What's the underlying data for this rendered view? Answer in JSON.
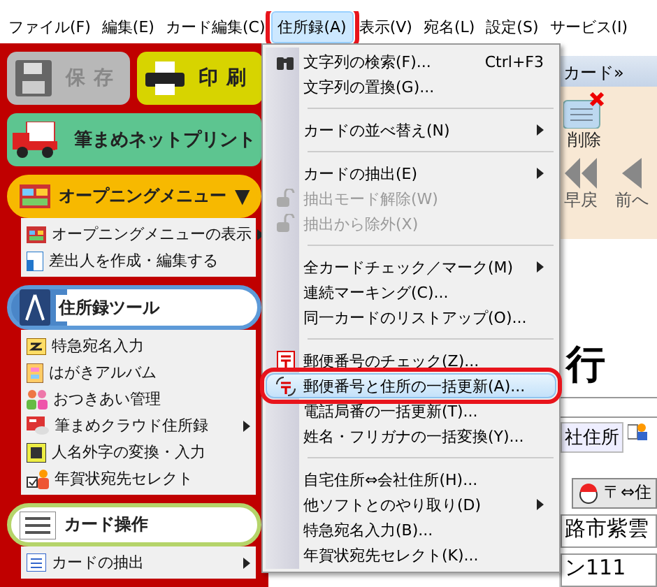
{
  "menu_bar": [
    {
      "label": "ファイル(F)",
      "selected": false,
      "callout": false
    },
    {
      "label": "編集(E)",
      "selected": false,
      "callout": false
    },
    {
      "label": "カード編集(C)",
      "selected": false,
      "callout": false
    },
    {
      "label": "住所録(A)",
      "selected": true,
      "callout": true
    },
    {
      "label": "表示(V)",
      "selected": false,
      "callout": false
    },
    {
      "label": "宛名(L)",
      "selected": false,
      "callout": false
    },
    {
      "label": "設定(S)",
      "selected": false,
      "callout": false
    },
    {
      "label": "サービス(I)",
      "selected": false,
      "callout": false
    }
  ],
  "left_panel": {
    "save_button": {
      "label": "保存",
      "disabled": true
    },
    "print_button": {
      "label": "印刷",
      "disabled": false
    },
    "net_print_button": {
      "label": "筆まめネットプリント"
    },
    "sections": [
      {
        "kind": "orange",
        "title": "オープニングメニュー",
        "toggle": "▼",
        "items": [
          {
            "label": "オープニングメニューの表示",
            "submenu": true
          },
          {
            "label": "差出人を作成・編集する",
            "submenu": false
          }
        ]
      },
      {
        "kind": "blue",
        "title": "住所録ツール",
        "items": [
          {
            "label": "特急宛名入力",
            "submenu": false
          },
          {
            "label": "はがきアルバム",
            "submenu": false
          },
          {
            "label": "おつきあい管理",
            "submenu": false
          },
          {
            "label": "筆まめクラウド住所録",
            "submenu": true
          },
          {
            "label": "人名外字の変換・入力",
            "submenu": false
          },
          {
            "label": "年賀状宛先セレクト",
            "submenu": false
          }
        ]
      },
      {
        "kind": "green",
        "title": "カード操作",
        "items": [
          {
            "label": "カードの抽出",
            "submenu": true
          }
        ]
      }
    ]
  },
  "dropdown": [
    {
      "kind": "item",
      "label": "文字列の検索(F)...",
      "shortcut": "Ctrl+F3",
      "submenu": false,
      "disabled": false,
      "selected": false,
      "callout": false
    },
    {
      "kind": "item",
      "label": "文字列の置換(G)...",
      "submenu": false,
      "disabled": false,
      "selected": false,
      "callout": false
    },
    {
      "kind": "separator"
    },
    {
      "kind": "item",
      "label": "カードの並べ替え(N)",
      "submenu": true,
      "disabled": false,
      "selected": false,
      "callout": false
    },
    {
      "kind": "separator"
    },
    {
      "kind": "item",
      "label": "カードの抽出(E)",
      "submenu": true,
      "disabled": false,
      "selected": false,
      "callout": false
    },
    {
      "kind": "item",
      "label": "抽出モード解除(W)",
      "submenu": false,
      "disabled": true,
      "selected": false,
      "callout": false
    },
    {
      "kind": "item",
      "label": "抽出から除外(X)",
      "submenu": false,
      "disabled": true,
      "selected": false,
      "callout": false
    },
    {
      "kind": "separator"
    },
    {
      "kind": "item",
      "label": "全カードチェック／マーク(M)",
      "submenu": true,
      "disabled": false,
      "selected": false,
      "callout": false
    },
    {
      "kind": "item",
      "label": "連続マーキング(C)...",
      "submenu": false,
      "disabled": false,
      "selected": false,
      "callout": false
    },
    {
      "kind": "item",
      "label": "同一カードのリストアップ(O)...",
      "submenu": false,
      "disabled": false,
      "selected": false,
      "callout": false
    },
    {
      "kind": "separator"
    },
    {
      "kind": "item",
      "label": "郵便番号のチェック(Z)...",
      "submenu": false,
      "disabled": false,
      "selected": false,
      "callout": false
    },
    {
      "kind": "item",
      "label": "郵便番号と住所の一括更新(A)...",
      "submenu": false,
      "disabled": false,
      "selected": true,
      "callout": true
    },
    {
      "kind": "item",
      "label": "電話局番の一括更新(T)...",
      "submenu": false,
      "disabled": false,
      "selected": false,
      "callout": false
    },
    {
      "kind": "item",
      "label": "姓名・フリガナの一括変換(Y)...",
      "submenu": false,
      "disabled": false,
      "selected": false,
      "callout": false
    },
    {
      "kind": "separator"
    },
    {
      "kind": "item",
      "label": "自宅住所⇔会社住所(H)...",
      "submenu": false,
      "disabled": false,
      "selected": false,
      "callout": false
    },
    {
      "kind": "item",
      "label": "他ソフトとのやり取り(D)",
      "submenu": true,
      "disabled": false,
      "selected": false,
      "callout": false
    },
    {
      "kind": "item",
      "label": "特急宛名入力(B)...",
      "submenu": false,
      "disabled": false,
      "selected": false,
      "callout": false
    },
    {
      "kind": "item",
      "label": "年賀状宛先セレクト(K)...",
      "submenu": false,
      "disabled": false,
      "selected": false,
      "callout": false
    }
  ],
  "card_area": {
    "tab": "カード»",
    "toolbar": [
      {
        "label": "削除"
      }
    ],
    "nav": [
      {
        "label": "早戻"
      },
      {
        "label": "前へ"
      }
    ],
    "heading": "行",
    "address_tabs": [
      {
        "label": "社住所"
      }
    ],
    "zip_button": "〒⇔住",
    "address": "路市紫雲",
    "building": "ン111"
  }
}
